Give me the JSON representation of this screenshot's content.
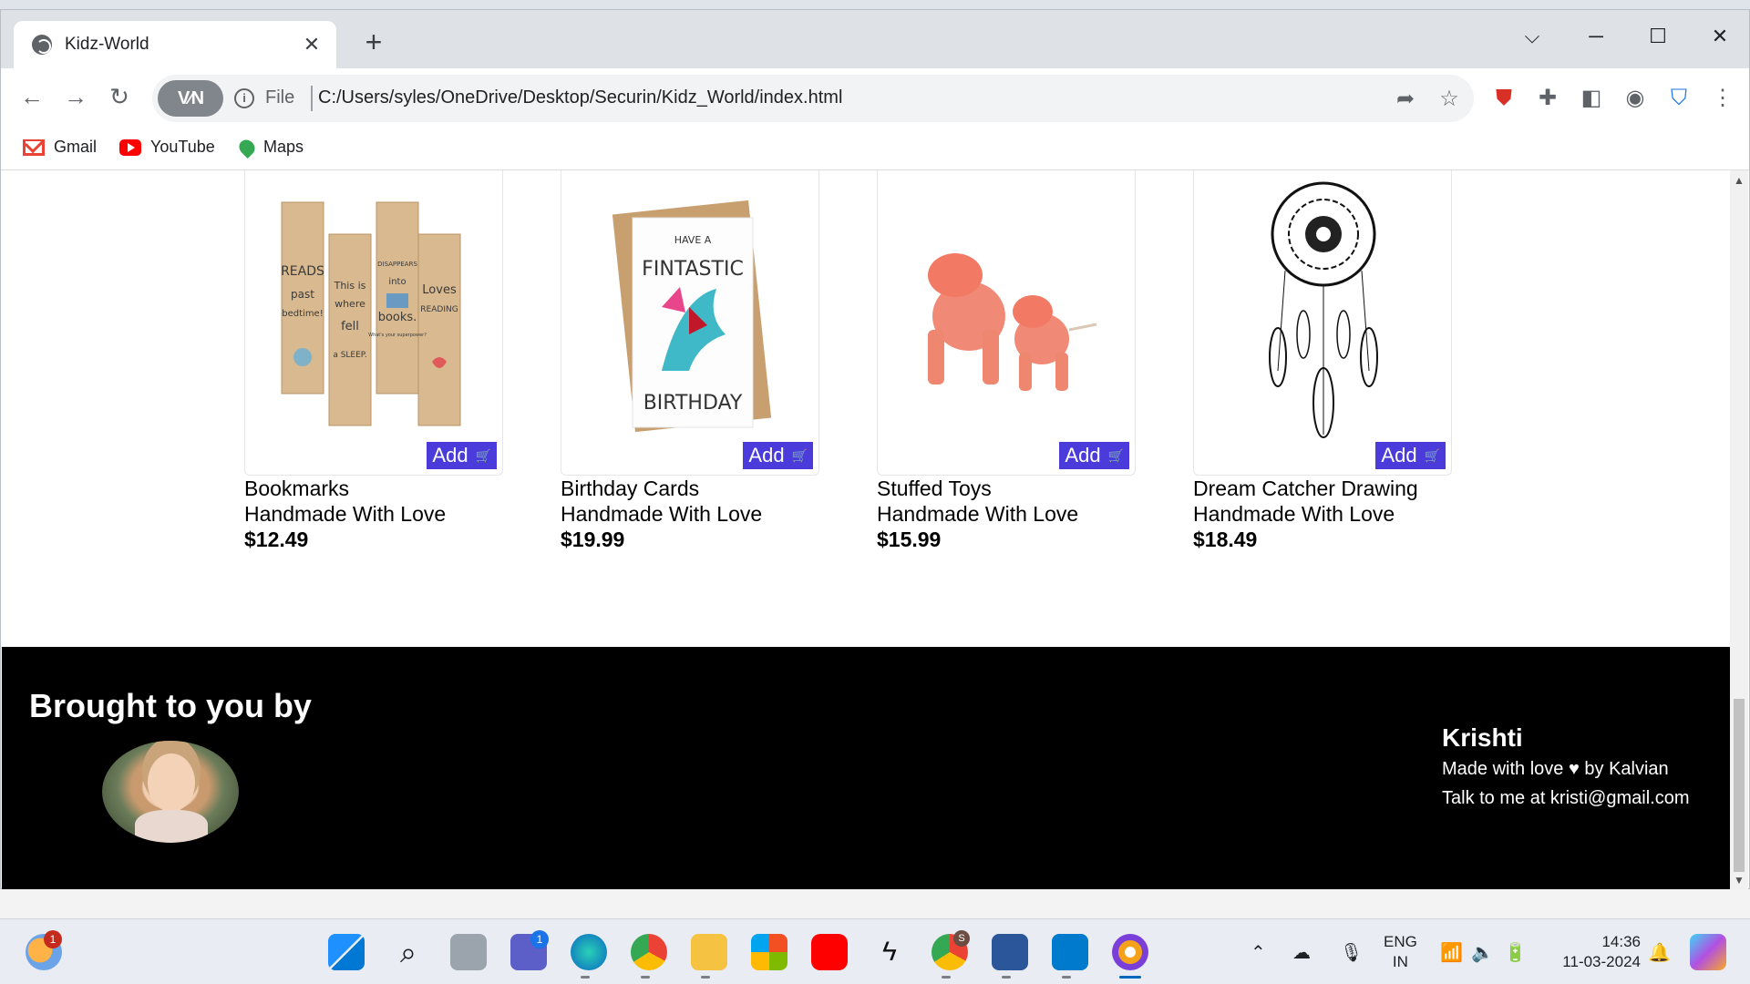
{
  "browser": {
    "tab_title": "Kidz-World",
    "tab_close": "✕",
    "new_tab": "+",
    "url_scheme": "File",
    "url": "C:/Users/syles/OneDrive/Desktop/Securin/Kidz_World/index.html",
    "vpn_label": "V∕N",
    "bookmarks": [
      {
        "label": "Gmail",
        "icon": "gmail-icon"
      },
      {
        "label": "YouTube",
        "icon": "youtube-icon"
      },
      {
        "label": "Maps",
        "icon": "maps-icon"
      }
    ]
  },
  "products": [
    {
      "name": "Bookmarks",
      "subtitle": "Handmade With Love",
      "price": "$12.49",
      "add_label": "Add",
      "image": "bookmarks-image"
    },
    {
      "name": "Birthday Cards",
      "subtitle": "Handmade With Love",
      "price": "$19.99",
      "add_label": "Add",
      "image": "birthday-card-image"
    },
    {
      "name": "Stuffed Toys",
      "subtitle": "Handmade With Love",
      "price": "$15.99",
      "add_label": "Add",
      "image": "stuffed-toys-image"
    },
    {
      "name": "Dream Catcher Drawing",
      "subtitle": "Handmade With Love",
      "price": "$18.49",
      "add_label": "Add",
      "image": "dream-catcher-image"
    }
  ],
  "bookmark_art": {
    "b1": [
      "READS",
      "past",
      "bedtime!"
    ],
    "b2": [
      "This is",
      "where",
      "fell",
      "a SLEEP."
    ],
    "b3": [
      "DISAPPEARS",
      "into",
      "books.",
      "What's your superpower?"
    ],
    "b4": [
      "Loves",
      "READING"
    ]
  },
  "birthday_art": {
    "line1": "HAVE A",
    "line2": "FINTASTIC",
    "line3": "BIRTHDAY"
  },
  "footer": {
    "title": "Brought to you by",
    "name": "Krishti",
    "line1": "Made with love ♥ by Kalvian",
    "line2": "Talk to me at kristi@gmail.com"
  },
  "taskbar": {
    "lang_top": "ENG",
    "lang_bottom": "IN",
    "time": "14:36",
    "date": "11-03-2024",
    "weather_badge": "1",
    "teams_badge": "1",
    "chrome_profile_badge": "S"
  },
  "colors": {
    "add_button": "#4b3bdb",
    "footer_bg": "#000000"
  }
}
